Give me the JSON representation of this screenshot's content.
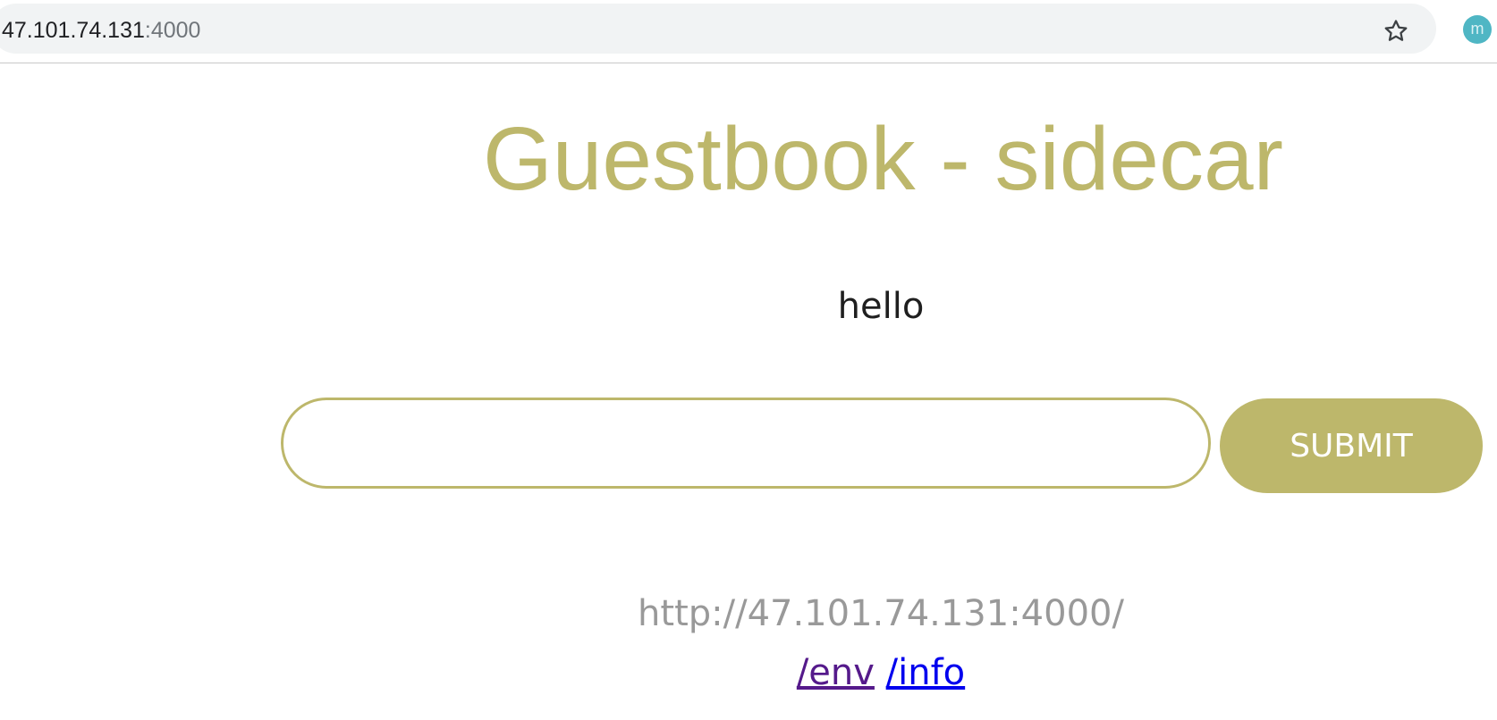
{
  "browser": {
    "url_host": "47.101.74.131",
    "url_port": ":4000",
    "profile_initial": "m",
    "star_icon": "star-outline-icon"
  },
  "page": {
    "title": "Guestbook - sidecar",
    "message": "hello",
    "input_value": "",
    "submit_label": "SUBMIT",
    "host_address": "http://47.101.74.131:4000/",
    "links": {
      "env": "/env",
      "info": "/info"
    }
  },
  "colors": {
    "accent": "#bdb76b",
    "visited_link": "#551a8b",
    "link": "#0000ee",
    "muted_text": "#999999"
  }
}
